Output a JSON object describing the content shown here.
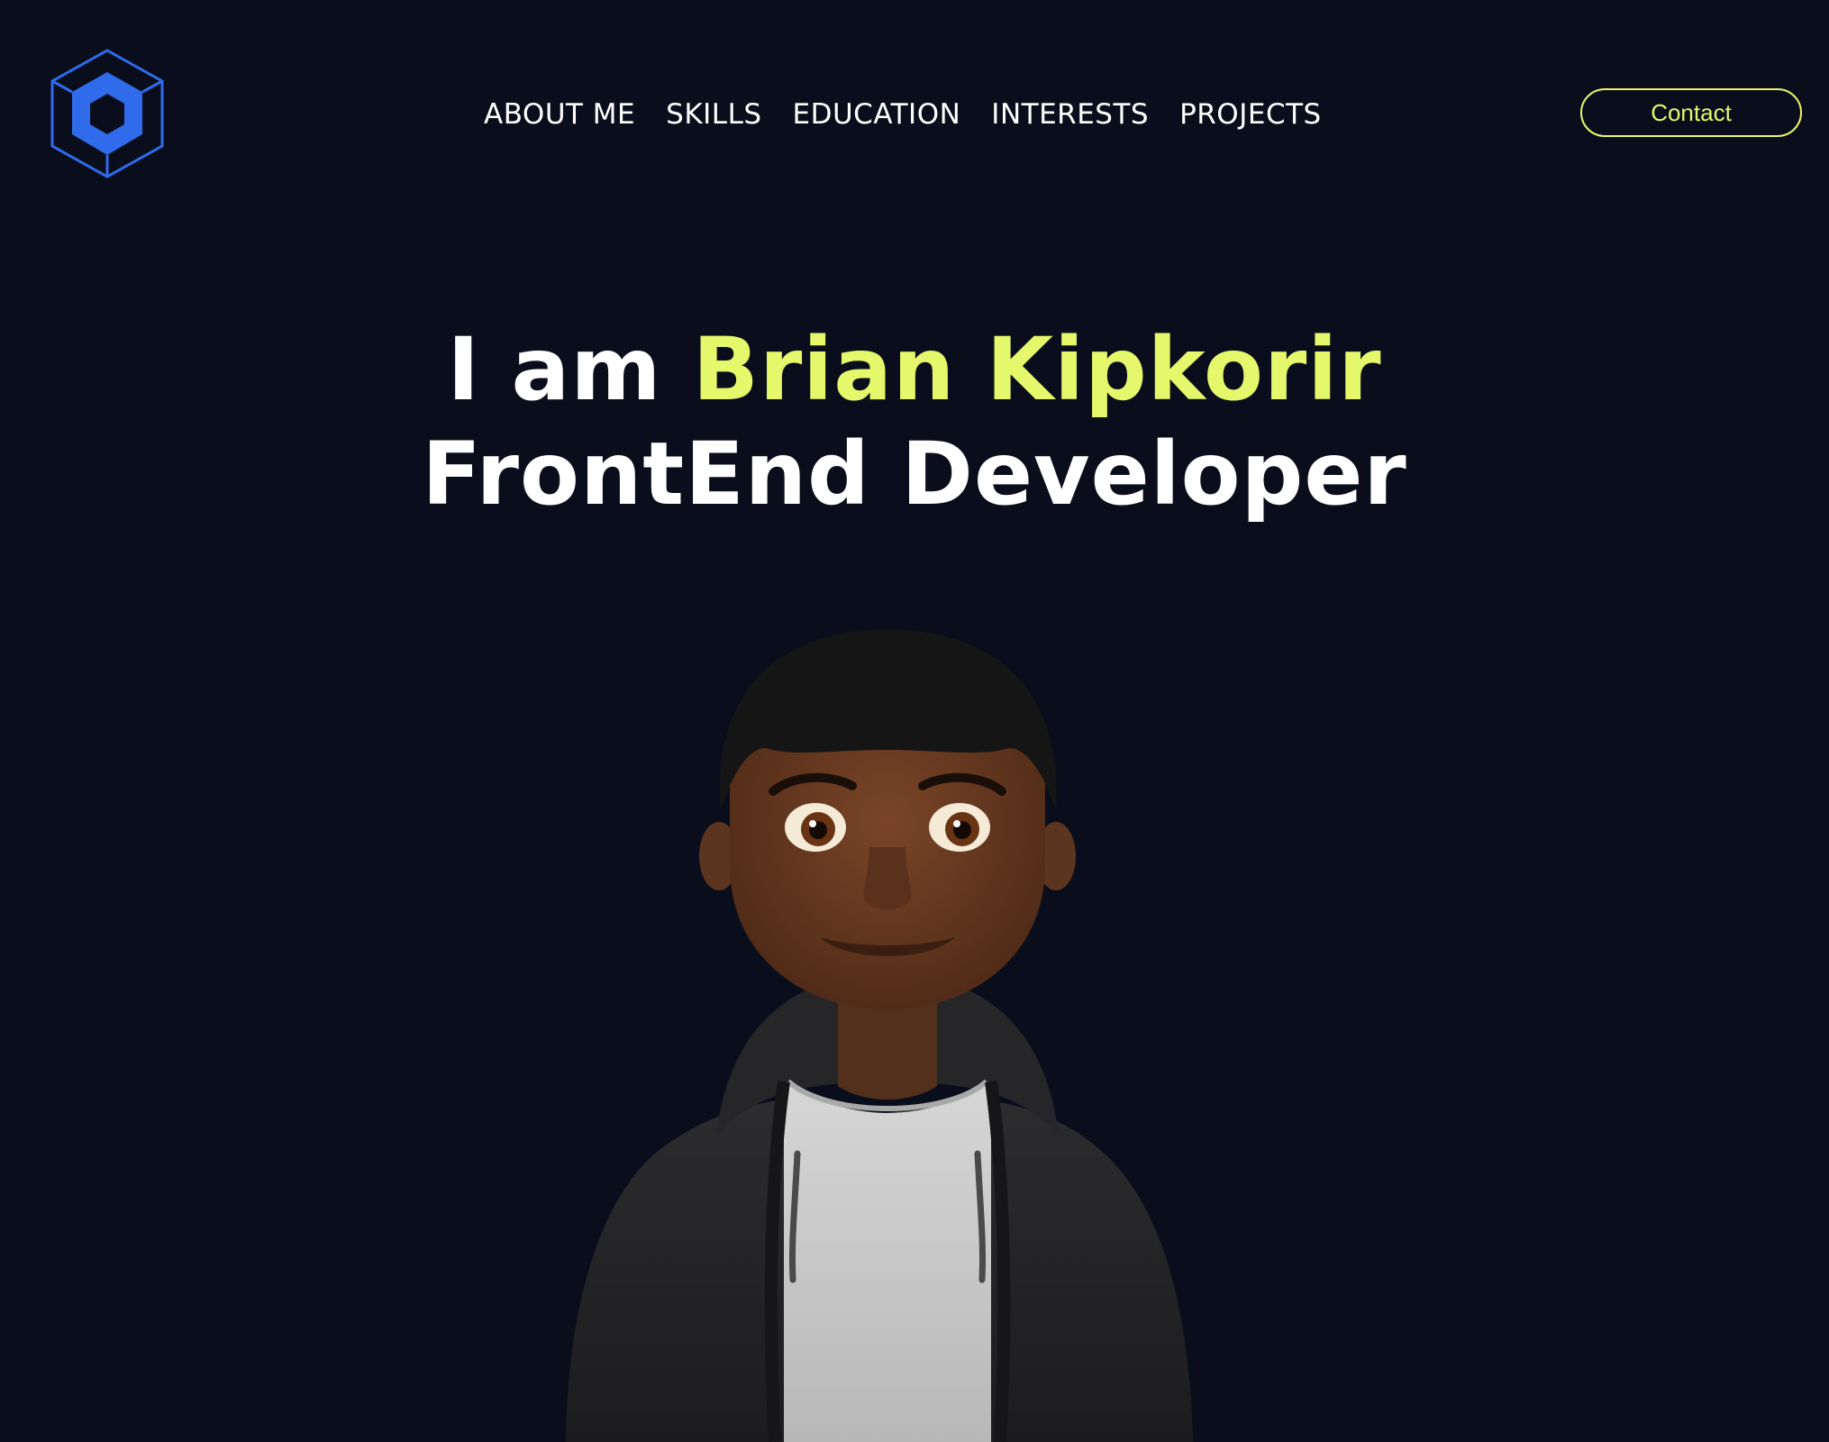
{
  "nav": {
    "items": [
      {
        "label": "ABOUT ME"
      },
      {
        "label": "SKILLS"
      },
      {
        "label": "EDUCATION"
      },
      {
        "label": "INTERESTS"
      },
      {
        "label": "PROJECTS"
      }
    ],
    "contact_label": "Contact"
  },
  "hero": {
    "prefix": "I am",
    "name": "Brian Kipkorir",
    "role": "FrontEnd Developer"
  },
  "colors": {
    "background": "#0a0e1c",
    "accent": "#e5f76a",
    "logo": "#2f6bea",
    "text": "#ffffff"
  },
  "icons": {
    "logo": "hexagon-cube-logo",
    "avatar": "developer-avatar-illustration"
  }
}
